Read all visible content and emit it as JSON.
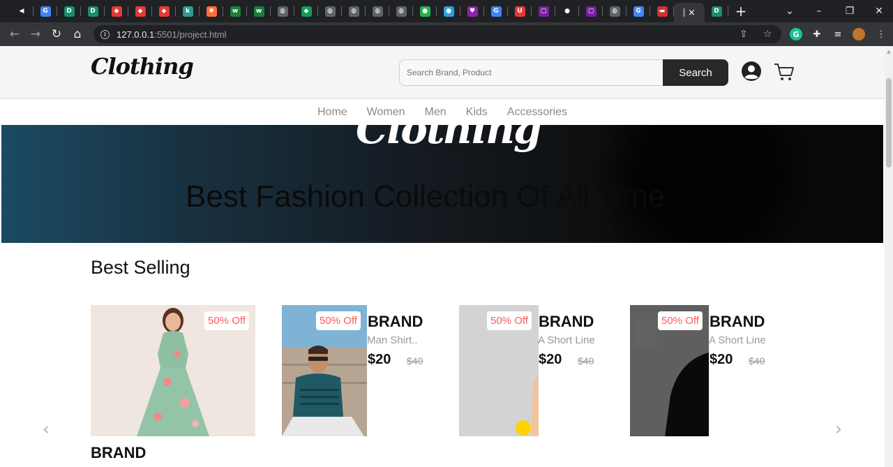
{
  "browser": {
    "tabs": [
      {
        "icon": "speaker-icon",
        "color": "#202124",
        "glyph": "◀"
      },
      {
        "icon": "google-icon",
        "color": "#4285f4",
        "glyph": "G"
      },
      {
        "icon": "d-app-icon",
        "color": "#1a8d6f",
        "glyph": "D"
      },
      {
        "icon": "d-app-icon",
        "color": "#1a8d6f",
        "glyph": "D"
      },
      {
        "icon": "diamond-red-icon",
        "color": "#e53935",
        "glyph": "◆"
      },
      {
        "icon": "diamond-red-icon",
        "color": "#e53935",
        "glyph": "◆"
      },
      {
        "icon": "diamond-red-icon",
        "color": "#e53935",
        "glyph": "◆"
      },
      {
        "icon": "k-icon",
        "color": "#2d9c8e",
        "glyph": "k"
      },
      {
        "icon": "asterisk-icon",
        "color": "#ff6d3a",
        "glyph": "✱"
      },
      {
        "icon": "w-icon",
        "color": "#1a7f3c",
        "glyph": "w"
      },
      {
        "icon": "w-icon",
        "color": "#1a7f3c",
        "glyph": "w"
      },
      {
        "icon": "globe-icon",
        "color": "#5f6368",
        "glyph": "◍"
      },
      {
        "icon": "green-diamond-icon",
        "color": "#0f9d58",
        "glyph": "◆"
      },
      {
        "icon": "globe-icon",
        "color": "#5f6368",
        "glyph": "◍"
      },
      {
        "icon": "globe-icon",
        "color": "#5f6368",
        "glyph": "◍"
      },
      {
        "icon": "globe-icon",
        "color": "#5f6368",
        "glyph": "◍"
      },
      {
        "icon": "globe-icon",
        "color": "#5f6368",
        "glyph": "◍"
      },
      {
        "icon": "chat-icon",
        "color": "#25b34a",
        "glyph": "●"
      },
      {
        "icon": "bag-icon",
        "color": "#2aa1e0",
        "glyph": "●"
      },
      {
        "icon": "heart-icon",
        "color": "#8e24aa",
        "glyph": "♥"
      },
      {
        "icon": "google-icon",
        "color": "#4285f4",
        "glyph": "G"
      },
      {
        "icon": "u-icon",
        "color": "#e53935",
        "glyph": "U"
      },
      {
        "icon": "bracket-icon",
        "color": "#7b1fa2",
        "glyph": "▢"
      },
      {
        "icon": "github-icon",
        "color": "#202124",
        "glyph": "●"
      },
      {
        "icon": "bracket-icon",
        "color": "#7b1fa2",
        "glyph": "▢"
      },
      {
        "icon": "globe-icon",
        "color": "#5f6368",
        "glyph": "◍"
      },
      {
        "icon": "google-icon",
        "color": "#4285f4",
        "glyph": "G"
      },
      {
        "icon": "store-icon",
        "color": "#d32f2f",
        "glyph": "▬"
      }
    ],
    "active_tab_close": "×",
    "after_tab": {
      "icon": "d-app-icon",
      "color": "#1a8d6f",
      "glyph": "D"
    },
    "new_tab": "+",
    "url_host": "127.0.0.1",
    "url_path": ":5501/project.html"
  },
  "site": {
    "logo": "Clothing",
    "search_placeholder": "Search Brand, Product",
    "search_button": "Search",
    "nav": [
      "Home",
      "Women",
      "Men",
      "Kids",
      "Accessories"
    ],
    "hero_logo": "Clothing",
    "hero_title": "Best Fashion Collection Of All Time",
    "section_title": "Best Selling",
    "prev_arrow": "‹",
    "next_arrow": "›"
  },
  "products": [
    {
      "badge": "50% Off",
      "brand": "BRAND",
      "desc": "",
      "price": "",
      "old_price": "",
      "image": "green-floral-dress"
    },
    {
      "badge": "50% Off",
      "brand": "BRAND",
      "desc": "Man Shirt..",
      "price": "$20",
      "old_price": "$40",
      "image": "man-teal-tshirt"
    },
    {
      "badge": "50% Off",
      "brand": "BRAND",
      "desc": "A Short Line",
      "price": "$20",
      "old_price": "$40",
      "image": "grey-backdrop"
    },
    {
      "badge": "50% Off",
      "brand": "BRAND",
      "desc": "A Short Line",
      "price": "$20",
      "old_price": "$40",
      "image": "black-jacket"
    }
  ]
}
